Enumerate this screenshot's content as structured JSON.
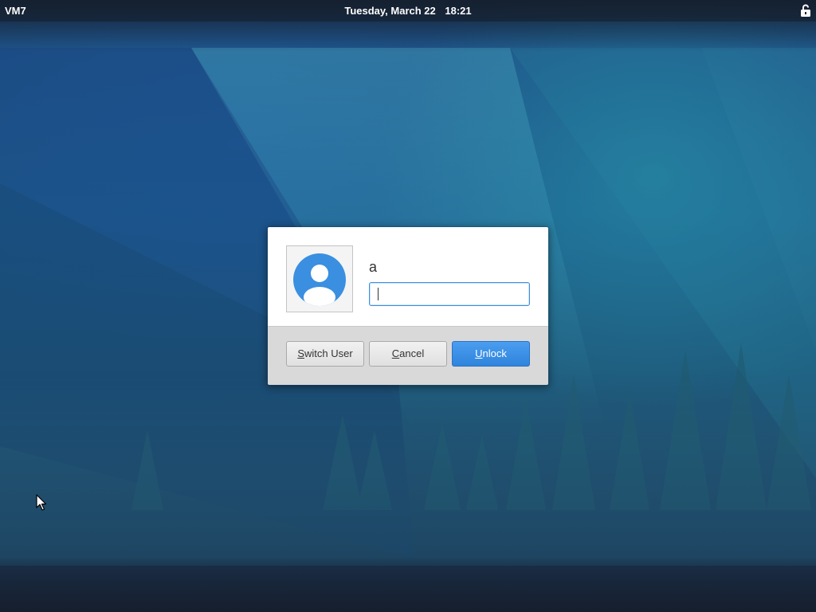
{
  "panel": {
    "app_label": "VM7",
    "date": "Tuesday, March 22",
    "time": "18:21",
    "indicator_icon": "lock-indicator-icon"
  },
  "dialog": {
    "avatar_icon": "user-avatar-icon",
    "username": "a",
    "password_value": "",
    "buttons": {
      "switch_user": {
        "mnemonic": "S",
        "rest": "witch User"
      },
      "cancel": {
        "mnemonic": "C",
        "rest": "ancel"
      },
      "unlock": {
        "mnemonic": "U",
        "rest": "nlock"
      }
    }
  },
  "colors": {
    "accent": "#3689e6",
    "panel_bg": "#141c28",
    "dialog_bg": "#ffffff",
    "dialog_footer": "#d9d9d9"
  }
}
